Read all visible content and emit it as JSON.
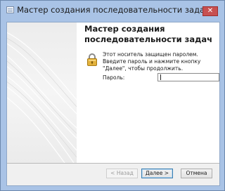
{
  "window": {
    "title": "Мастер создания последовательности задач",
    "close_label": "✕"
  },
  "page": {
    "heading": "Мастер создания последовательности задач",
    "message": "Этот носитель защищен паролем. Введите пароль и нажмите кнопку \"Далее\", чтобы продолжить.",
    "password_label": "Пароль:",
    "password_value": ""
  },
  "buttons": {
    "back": "< Назад",
    "next": "Далее >",
    "cancel": "Отмена"
  },
  "icons": {
    "app": "wizard-window-icon",
    "lock": "padlock-icon"
  },
  "colors": {
    "window_frame": "#a9c3e6",
    "close_button": "#c75050",
    "lock_gold": "#e3b23c"
  }
}
